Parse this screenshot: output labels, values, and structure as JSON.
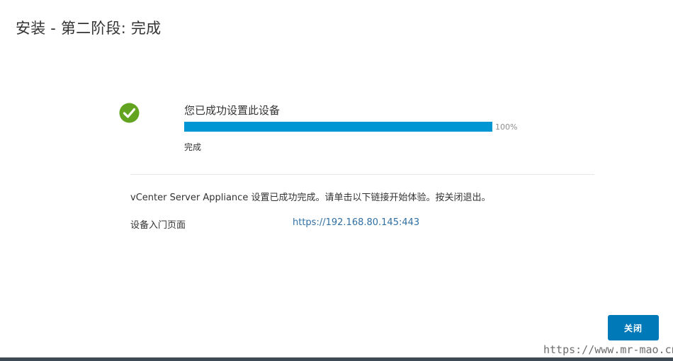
{
  "header": {
    "title": "安装 - 第二阶段: 完成"
  },
  "status": {
    "icon": "check-circle-icon",
    "icon_color": "#62a420",
    "heading": "您已成功设置此设备",
    "progress_value": 100,
    "progress_text": "100%",
    "progress_color": "#0095d3",
    "state_text": "完成"
  },
  "result": {
    "message": "vCenter Server Appliance 设置已成功完成。请单击以下链接开始体验。按关闭退出。",
    "portal_label": "设备入门页面",
    "portal_url": "https://192.168.80.145:443"
  },
  "footer": {
    "close_label": "关闭",
    "accent_color": "#0079b8"
  },
  "watermark": {
    "text": "https://www.mr-mao.cn"
  }
}
